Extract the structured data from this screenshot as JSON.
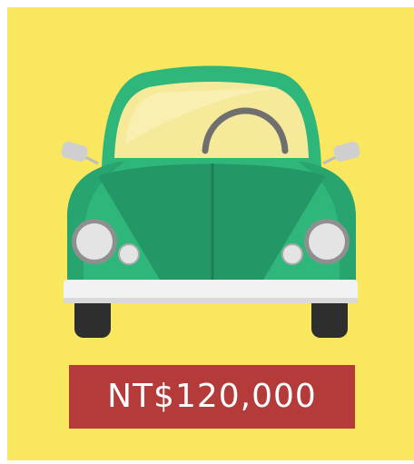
{
  "illustration": {
    "icon": "car-front-icon",
    "colors": {
      "background": "#f8e75f",
      "body": "#2fb67b",
      "body_dark": "#239866",
      "windshield": "#f6ea9a",
      "bumper": "#f2f2f2",
      "tires": "#2e2e2e"
    }
  },
  "price": {
    "label": "NT$120,000",
    "background": "#b53a3a"
  }
}
